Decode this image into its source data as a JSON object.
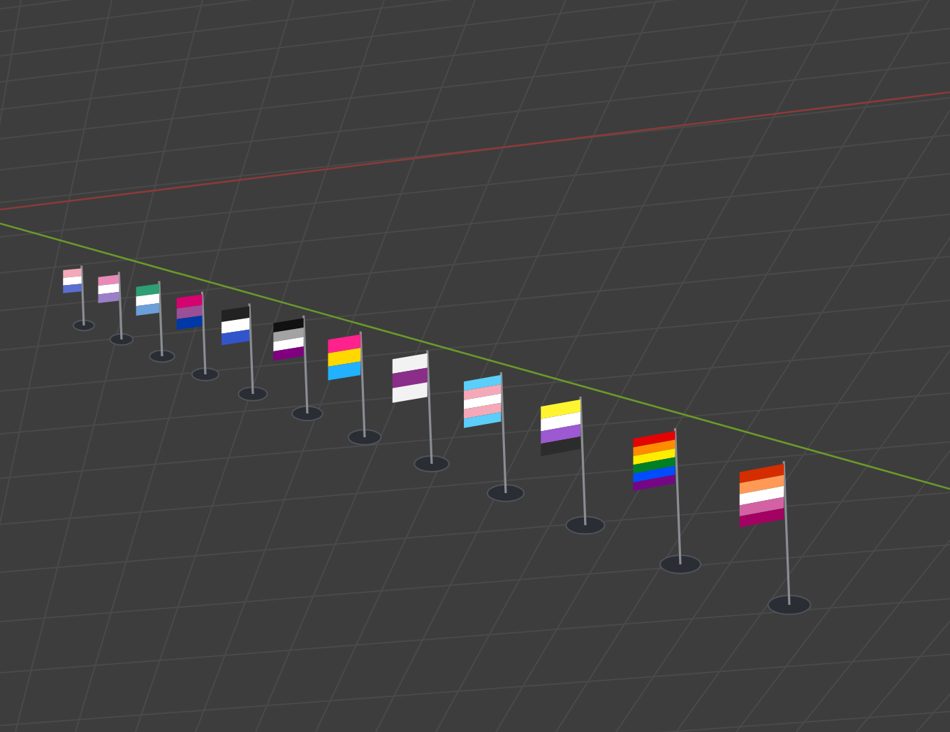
{
  "viewport": {
    "flags": [
      {
        "stripes": [
          {
            "color": "#f5a9b8"
          },
          {
            "color": "#ffffff"
          },
          {
            "color": "#5b6fd0"
          }
        ]
      },
      {
        "stripes": [
          {
            "color": "#e88ab8"
          },
          {
            "color": "#ffffff"
          },
          {
            "color": "#9b7fc8"
          }
        ]
      },
      {
        "stripes": [
          {
            "color": "#2e9e74"
          },
          {
            "color": "#ffffff"
          },
          {
            "color": "#6b9fd8"
          }
        ]
      },
      {
        "stripes": [
          {
            "color": "#d60270"
          },
          {
            "color": "#9b4f96"
          },
          {
            "color": "#0038a8"
          }
        ]
      },
      {
        "stripes": [
          {
            "color": "#222222"
          },
          {
            "color": "#ffffff"
          },
          {
            "color": "#3355cc"
          }
        ]
      },
      {
        "stripes": [
          {
            "color": "#111111"
          },
          {
            "color": "#a3a3a3"
          },
          {
            "color": "#ffffff"
          },
          {
            "color": "#800080"
          }
        ]
      },
      {
        "stripes": [
          {
            "color": "#ff218c"
          },
          {
            "color": "#ffd800"
          },
          {
            "color": "#21b1ff"
          }
        ]
      },
      {
        "stripes": [
          {
            "color": "#f2f2f2"
          },
          {
            "color": "#8a2e8a"
          },
          {
            "color": "#f2f2f2"
          }
        ]
      },
      {
        "stripes": [
          {
            "color": "#5bcefa"
          },
          {
            "color": "#f5a9b8"
          },
          {
            "color": "#ffffff"
          },
          {
            "color": "#f5a9b8"
          },
          {
            "color": "#5bcefa"
          }
        ]
      },
      {
        "stripes": [
          {
            "color": "#fff430"
          },
          {
            "color": "#ffffff"
          },
          {
            "color": "#9c59d1"
          },
          {
            "color": "#2c2c2c"
          }
        ]
      },
      {
        "stripes": [
          {
            "color": "#e40303"
          },
          {
            "color": "#ff8c00"
          },
          {
            "color": "#ffed00"
          },
          {
            "color": "#008026"
          },
          {
            "color": "#004dff"
          },
          {
            "color": "#750787"
          }
        ]
      },
      {
        "stripes": [
          {
            "color": "#d52d00"
          },
          {
            "color": "#ff9a56"
          },
          {
            "color": "#ffffff"
          },
          {
            "color": "#d362a4"
          },
          {
            "color": "#a30262"
          }
        ]
      }
    ]
  }
}
